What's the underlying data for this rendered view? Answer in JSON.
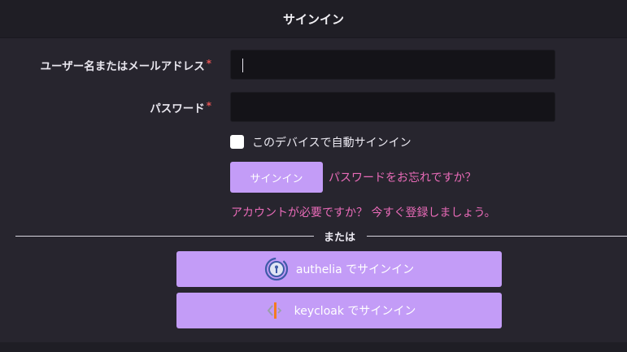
{
  "header": {
    "title": "サインイン"
  },
  "form": {
    "username_label": "ユーザー名またはメールアドレス",
    "password_label": "パスワード",
    "required_marker": "*",
    "username_value": "",
    "password_value": "",
    "remember_label": "このデバイスで自動サインイン",
    "remember_checked": false,
    "signin_button": "サインイン",
    "forgot_password_link": "パスワードをお忘れですか？",
    "register_link": "アカウントが必要ですか？ 今すぐ登録しましょう。"
  },
  "divider": {
    "text": "または"
  },
  "sso": [
    {
      "label": "authelia でサインイン",
      "icon": "authelia-logo-icon"
    },
    {
      "label": "keycloak でサインイン",
      "icon": "keycloak-logo-icon"
    }
  ],
  "colors": {
    "background": "#27252e",
    "header": "#1f1e25",
    "input": "#141318",
    "accent": "#c39cf7",
    "link": "#e96bb8",
    "required": "#e55353"
  }
}
